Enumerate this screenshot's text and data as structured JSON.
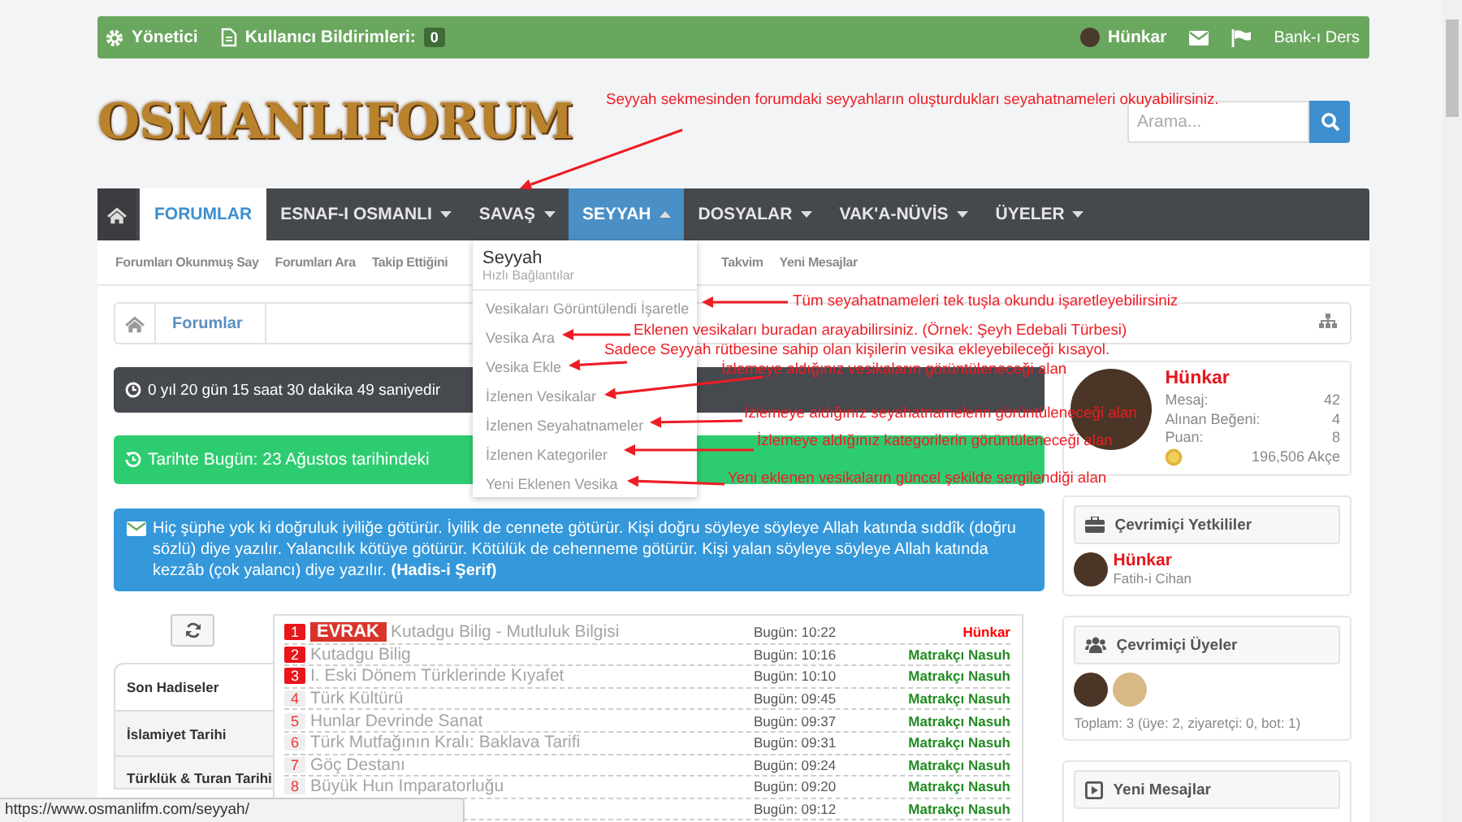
{
  "top_bar": {
    "items": [
      {
        "label": "Yönetici"
      },
      {
        "label": "Kullanıcı Bildirimleri:",
        "badge": "0"
      }
    ],
    "user": "Hünkar",
    "link": "Bank-ı Ders"
  },
  "logo": "OSMANLIFORUM",
  "search": {
    "placeholder": "Arama..."
  },
  "nav": {
    "items": [
      {
        "label": "FORUMLAR",
        "selected": true,
        "expanded": false,
        "has_menu": false
      },
      {
        "label": "ESNAF-I OSMANLI",
        "selected": false,
        "expanded": false,
        "has_menu": true
      },
      {
        "label": "SAVAŞ",
        "selected": false,
        "expanded": false,
        "has_menu": true
      },
      {
        "label": "SEYYAH",
        "selected": false,
        "expanded": true,
        "has_menu": true
      },
      {
        "label": "DOSYALAR",
        "selected": false,
        "expanded": false,
        "has_menu": true
      },
      {
        "label": "VAK'A-NÜVİS",
        "selected": false,
        "expanded": false,
        "has_menu": true
      },
      {
        "label": "ÜYELER",
        "selected": false,
        "expanded": false,
        "has_menu": true
      }
    ]
  },
  "subnav": [
    "Forumları Okunmuş Say",
    "Forumları Ara",
    "Takip Ettiğini",
    "Takvim",
    "Yeni Mesajlar"
  ],
  "dropdown": {
    "title": "Seyyah",
    "subtitle": "Hızlı Bağlantılar",
    "items": [
      "Vesikaları Görüntülendi İşaretle",
      "Vesika Ara",
      "Vesika Ekle",
      "İzlenen Vesikalar",
      "İzlenen Seyahatnameler",
      "İzlenen Kategoriler",
      "Yeni Eklenen Vesika"
    ]
  },
  "breadcrumb": [
    "Forumlar"
  ],
  "notices": [
    {
      "kind": "timer",
      "text": "0 yıl 20 gün 15 saat 30 dakika 49 saniyedir"
    },
    {
      "kind": "history",
      "text": "Tarihte Bugün: 23 Ağustos tarihindeki"
    },
    {
      "kind": "quote",
      "text": "Hiç şüphe yok ki doğruluk iyiliğe götürür. İyilik de cennete götürür. Kişi doğru söyleye söyleye Allah katında sıddîk (doğru sözlü) diye yazılır. Yalancılık kötüye götürür. Kötülük de cehenneme götürür. Kişi yalan söyleye söyleye Allah katında kezzâb (çok yalancı) diye yazılır. **(Hadis-i Şerif)**"
    }
  ],
  "tabs": [
    {
      "label": "Son Hadiseler",
      "selected": true
    },
    {
      "label": "İslamiyet Tarihi",
      "selected": false
    },
    {
      "label": "Türklük & Turan Tarihi",
      "selected": false
    }
  ],
  "rows": [
    {
      "kind": "top",
      "number": "1",
      "tag": "EVRAK",
      "title": "Kutadgu Bilig - Mutluluk Bilgisi",
      "time": "Bugün: 10:22",
      "user": "Hünkar",
      "color": "#ff0000"
    },
    {
      "kind": "top",
      "number": "2",
      "title": "Kutadgu Bilig",
      "time": "Bugün: 10:16",
      "user": "Matrakçı Nasuh",
      "color": "#228b22"
    },
    {
      "kind": "top",
      "number": "3",
      "title": "I. Eski Dönem Türklerinde Kıyafet",
      "time": "Bugün: 10:10",
      "user": "Matrakçı Nasuh",
      "color": "#228b22"
    },
    {
      "kind": "plain",
      "number": "4",
      "title": "Türk Kültürü",
      "time": "Bugün: 09:45",
      "user": "Matrakçı Nasuh",
      "color": "#228b22"
    },
    {
      "kind": "plain",
      "number": "5",
      "title": "Hunlar Devrinde Sanat",
      "time": "Bugün: 09:37",
      "user": "Matrakçı Nasuh",
      "color": "#228b22"
    },
    {
      "kind": "plain",
      "number": "6",
      "title": "Türk Mutfağının Kralı: Baklava Tarifi",
      "time": "Bugün: 09:31",
      "user": "Matrakçı Nasuh",
      "color": "#228b22"
    },
    {
      "kind": "plain",
      "number": "7",
      "title": "Göç Destanı",
      "time": "Bugün: 09:24",
      "user": "Matrakçı Nasuh",
      "color": "#228b22"
    },
    {
      "kind": "plain",
      "number": "8",
      "title": "Büyük Hun Imparatorluğu",
      "time": "Bugün: 09:20",
      "user": "Matrakçı Nasuh",
      "color": "#228b22"
    },
    {
      "time": "Bugün: 09:12",
      "user": "Matrakçı Nasuh",
      "color": "#228b22"
    }
  ],
  "sidebar": {
    "profile": {
      "name": "Hünkar",
      "stats": [
        {
          "label": "Mesaj:",
          "value": "42"
        },
        {
          "label": "Alınan Beğeni:",
          "value": "4"
        },
        {
          "label": "Puan:",
          "value": "8"
        }
      ],
      "currency": "196,506 Akçe"
    },
    "staff": {
      "title": "Çevrimiçi Yetkililer",
      "members": [
        {
          "name": "Hünkar",
          "rank": "Fatih-i Cihan"
        }
      ]
    },
    "online": {
      "title": "Çevrimiçi Üyeler",
      "total": "Toplam: 3 (üye: 2, ziyaretçi: 0, bot: 1)"
    },
    "latest": {
      "title": "Yeni Mesajlar"
    }
  },
  "annotations": [
    "Seyyah sekmesinden forumdaki seyyahların oluşturdukları seyahatnameleri okuyabilirsiniz.",
    "Tüm seyahatnameleri tek tuşla okundu işaretleyebilirsiniz",
    "Eklenen vesikaları buradan arayabilirsiniz. (Örnek: Şeyh Edebali Türbesi)",
    "Sadece Seyyah rütbesine sahip olan kişilerin vesika ekleyebileceği kısayol.",
    "İzlemeye aldığınız vesikaların görüntüleneceği alan",
    "İzlemeye aldığınız seyahatnamelerin görüntüleneceği alan",
    "İzlemeye aldığınız kategorilerin görüntüleneceği alan",
    "Yeni eklenen vesikaların güncel şekilde sergilendiği alan"
  ],
  "status_bar": {
    "url": "https://www.osmanlifm.com/seyyah/"
  }
}
